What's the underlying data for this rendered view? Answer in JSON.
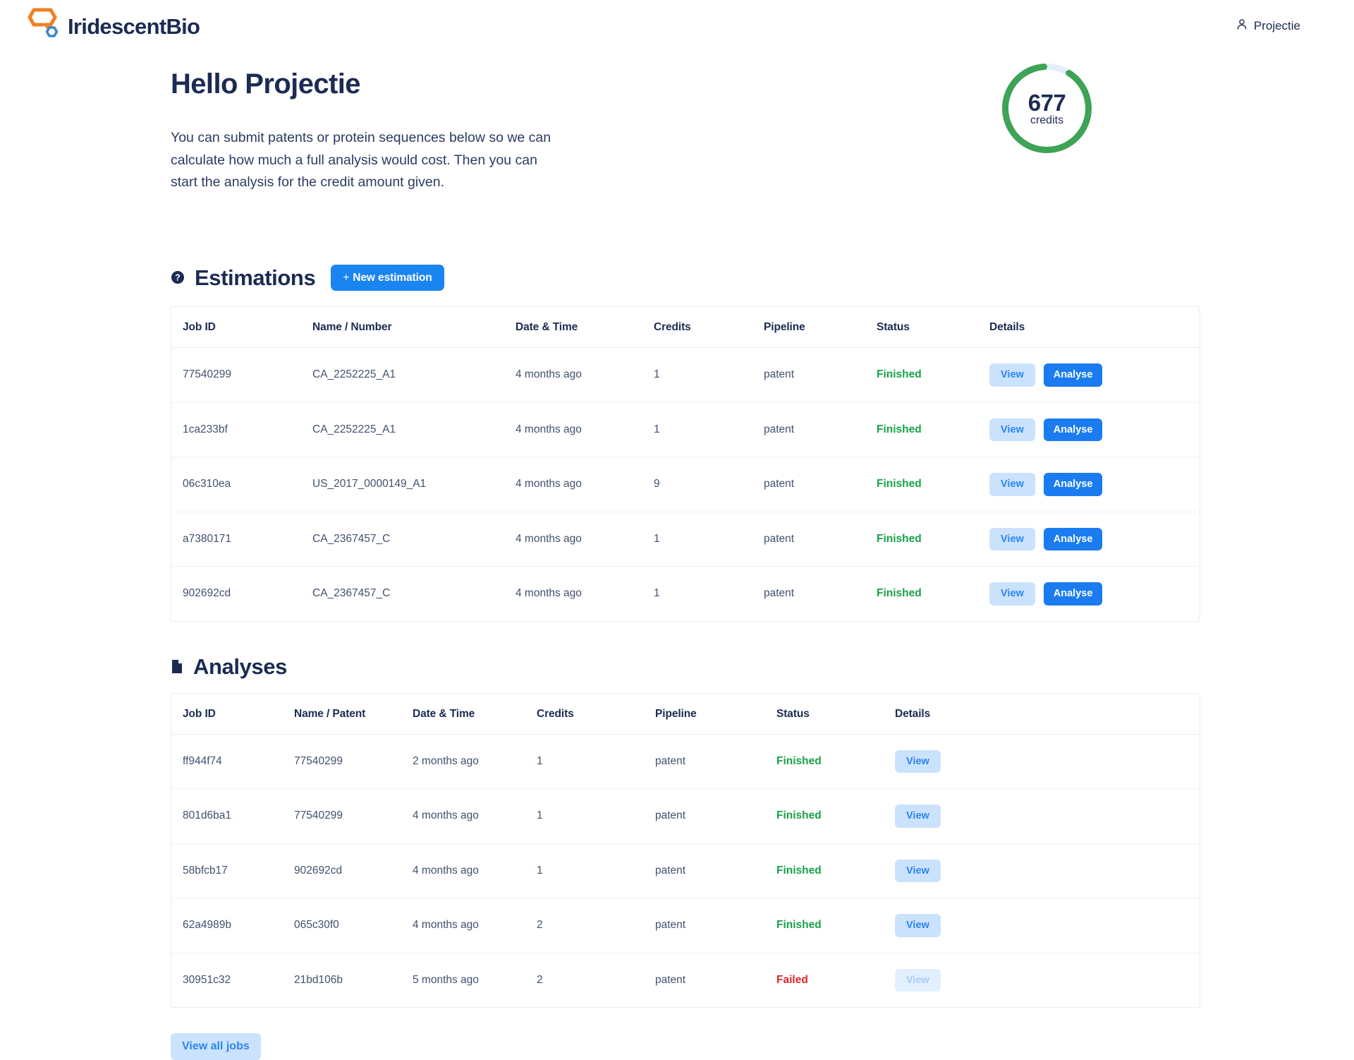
{
  "brand": {
    "name": "IridescentBio",
    "logo_orange": "#f08023",
    "logo_blue": "#3d87c8",
    "text_color": "#1b2b53"
  },
  "topbar": {
    "user_label": "Projectie",
    "user_icon": "person-icon"
  },
  "hero": {
    "title": "Hello Projectie",
    "description": "You can submit patents or protein sequences below so we can calculate how much a full analysis would cost. Then you can start the analysis for the credit amount given."
  },
  "credits": {
    "value": "677",
    "label": "credits",
    "ring_color": "#3da355",
    "track_color": "#e3eefb",
    "percent": 90
  },
  "estimations": {
    "icon": "question-circle-icon",
    "title": "Estimations",
    "new_button": {
      "plus": "+",
      "label": "New estimation",
      "color": "#1a84f0"
    },
    "columns": [
      "Job ID",
      "Name / Number",
      "Date & Time",
      "Credits",
      "Pipeline",
      "Status",
      "Details"
    ],
    "rows": [
      {
        "job_id": "77540299",
        "name": "CA_2252225_A1",
        "datetime": "4 months ago",
        "credits": "1",
        "pipeline": "patent",
        "status": "Finished",
        "view_label": "View",
        "analyse_label": "Analyse",
        "analyse_enabled": true
      },
      {
        "job_id": "1ca233bf",
        "name": "CA_2252225_A1",
        "datetime": "4 months ago",
        "credits": "1",
        "pipeline": "patent",
        "status": "Finished",
        "view_label": "View",
        "analyse_label": "Analyse",
        "analyse_enabled": true
      },
      {
        "job_id": "06c310ea",
        "name": "US_2017_0000149_A1",
        "datetime": "4 months ago",
        "credits": "9",
        "pipeline": "patent",
        "status": "Finished",
        "view_label": "View",
        "analyse_label": "Analyse",
        "analyse_enabled": true
      },
      {
        "job_id": "a7380171",
        "name": "CA_2367457_C",
        "datetime": "4 months ago",
        "credits": "1",
        "pipeline": "patent",
        "status": "Finished",
        "view_label": "View",
        "analyse_label": "Analyse",
        "analyse_enabled": true
      },
      {
        "job_id": "902692cd",
        "name": "CA_2367457_C",
        "datetime": "4 months ago",
        "credits": "1",
        "pipeline": "patent",
        "status": "Finished",
        "view_label": "View",
        "analyse_label": "Analyse",
        "analyse_enabled": true
      }
    ]
  },
  "analyses": {
    "icon": "document-icon",
    "title": "Analyses",
    "columns": [
      "Job ID",
      "Name / Patent",
      "Date & Time",
      "Credits",
      "Pipeline",
      "Status",
      "Details"
    ],
    "rows": [
      {
        "job_id": "ff944f74",
        "name": "77540299",
        "datetime": "2 months ago",
        "credits": "1",
        "pipeline": "patent",
        "status": "Finished",
        "view_label": "View",
        "view_enabled": true
      },
      {
        "job_id": "801d6ba1",
        "name": "77540299",
        "datetime": "4 months ago",
        "credits": "1",
        "pipeline": "patent",
        "status": "Finished",
        "view_label": "View",
        "view_enabled": true
      },
      {
        "job_id": "58bfcb17",
        "name": "902692cd",
        "datetime": "4 months ago",
        "credits": "1",
        "pipeline": "patent",
        "status": "Finished",
        "view_label": "View",
        "view_enabled": true
      },
      {
        "job_id": "62a4989b",
        "name": "065c30f0",
        "datetime": "4 months ago",
        "credits": "2",
        "pipeline": "patent",
        "status": "Finished",
        "view_label": "View",
        "view_enabled": true
      },
      {
        "job_id": "30951c32",
        "name": "21bd106b",
        "datetime": "5 months ago",
        "credits": "2",
        "pipeline": "patent",
        "status": "Failed",
        "view_label": "View",
        "view_enabled": false
      }
    ],
    "view_all_label": "View all jobs"
  },
  "status_colors": {
    "finished": "#18a249",
    "failed": "#e0252b"
  }
}
